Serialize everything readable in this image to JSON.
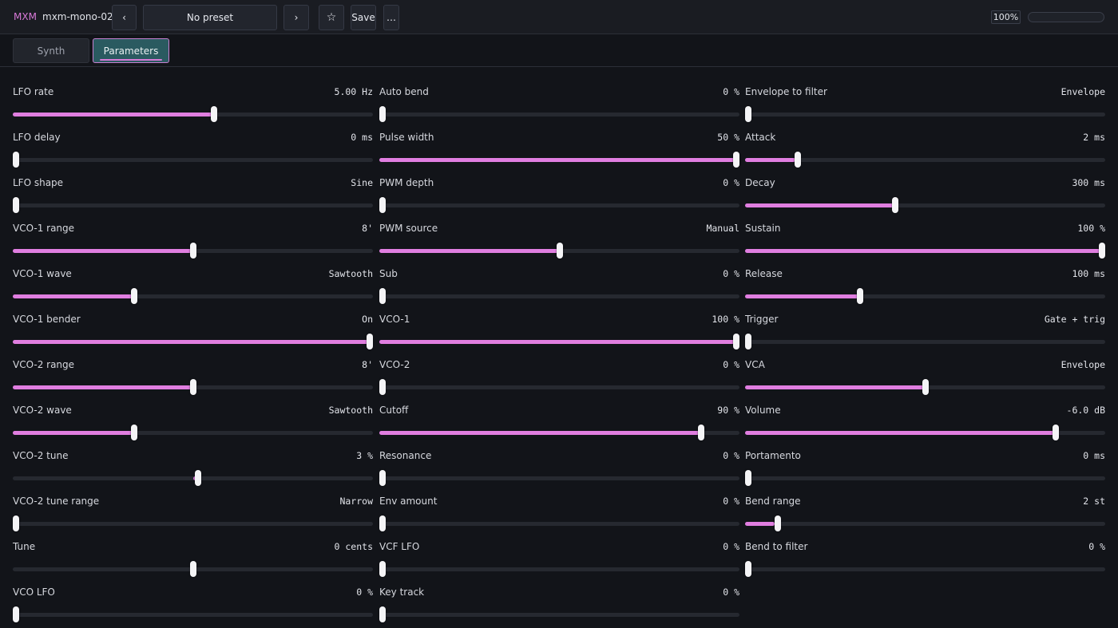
{
  "topbar": {
    "brand": "MXM",
    "patch_name": "mxm-mono-02",
    "prev_label": "‹",
    "preset_label": "No preset",
    "next_label": "›",
    "star_label": "☆",
    "save_label": "Save",
    "more_label": "…",
    "zoom": "100%",
    "cpu_level": 0
  },
  "tabs": [
    {
      "label": "Synth",
      "active": false
    },
    {
      "label": "Parameters",
      "active": true
    }
  ],
  "colors": {
    "accent": "#e07ee0",
    "active_tab_bg": "#2a5a60",
    "background": "#121419"
  },
  "params": [
    [
      {
        "name": "LFO rate",
        "value": "5.00 Hz",
        "level": 0.56,
        "bipolar": false
      },
      {
        "name": "LFO delay",
        "value": "0 ms",
        "level": 0,
        "bipolar": false
      },
      {
        "name": "LFO shape",
        "value": "Sine",
        "level": 0,
        "bipolar": false
      },
      {
        "name": "VCO-1 range",
        "value": "8'",
        "level": 0.5,
        "bipolar": false
      },
      {
        "name": "VCO-1 wave",
        "value": "Sawtooth",
        "level": 0.333,
        "bipolar": false
      },
      {
        "name": "VCO-1 bender",
        "value": "On",
        "level": 1,
        "bipolar": false
      },
      {
        "name": "VCO-2 range",
        "value": "8'",
        "level": 0.5,
        "bipolar": false
      },
      {
        "name": "VCO-2 wave",
        "value": "Sawtooth",
        "level": 0.333,
        "bipolar": false
      },
      {
        "name": "VCO-2 tune",
        "value": "3 %",
        "level": 0.515,
        "bipolar": true
      },
      {
        "name": "VCO-2 tune range",
        "value": "Narrow",
        "level": 0,
        "bipolar": false
      },
      {
        "name": "Tune",
        "value": "0 cents",
        "level": 0.5,
        "bipolar": true
      },
      {
        "name": "VCO LFO",
        "value": "0 %",
        "level": 0,
        "bipolar": false
      }
    ],
    [
      {
        "name": "Auto bend",
        "value": "0 %",
        "level": 0,
        "bipolar": false
      },
      {
        "name": "Pulse width",
        "value": "50 %",
        "level": 1,
        "bipolar": false
      },
      {
        "name": "PWM depth",
        "value": "0 %",
        "level": 0,
        "bipolar": false
      },
      {
        "name": "PWM source",
        "value": "Manual",
        "level": 0.5,
        "bipolar": false
      },
      {
        "name": "Sub",
        "value": "0 %",
        "level": 0,
        "bipolar": false
      },
      {
        "name": "VCO-1",
        "value": "100 %",
        "level": 1,
        "bipolar": false
      },
      {
        "name": "VCO-2",
        "value": "0 %",
        "level": 0,
        "bipolar": false
      },
      {
        "name": "Cutoff",
        "value": "90 %",
        "level": 0.9,
        "bipolar": false
      },
      {
        "name": "Resonance",
        "value": "0 %",
        "level": 0,
        "bipolar": false
      },
      {
        "name": "Env amount",
        "value": "0 %",
        "level": 0,
        "bipolar": false
      },
      {
        "name": "VCF LFO",
        "value": "0 %",
        "level": 0,
        "bipolar": false
      },
      {
        "name": "Key track",
        "value": "0 %",
        "level": 0,
        "bipolar": false
      }
    ],
    [
      {
        "name": "Envelope to filter",
        "value": "Envelope",
        "level": 0,
        "bipolar": false
      },
      {
        "name": "Attack",
        "value": "2 ms",
        "level": 0.14,
        "bipolar": false
      },
      {
        "name": "Decay",
        "value": "300 ms",
        "level": 0.415,
        "bipolar": false
      },
      {
        "name": "Sustain",
        "value": "100 %",
        "level": 1,
        "bipolar": false
      },
      {
        "name": "Release",
        "value": "100 ms",
        "level": 0.315,
        "bipolar": false
      },
      {
        "name": "Trigger",
        "value": "Gate + trig",
        "level": 0,
        "bipolar": false
      },
      {
        "name": "VCA",
        "value": "Envelope",
        "level": 0.5,
        "bipolar": false
      },
      {
        "name": "Volume",
        "value": "-6.0 dB",
        "level": 0.87,
        "bipolar": false
      },
      {
        "name": "Portamento",
        "value": "0 ms",
        "level": 0,
        "bipolar": false
      },
      {
        "name": "Bend range",
        "value": "2 st",
        "level": 0.083,
        "bipolar": false
      },
      {
        "name": "Bend to filter",
        "value": "0 %",
        "level": 0,
        "bipolar": false
      }
    ]
  ]
}
